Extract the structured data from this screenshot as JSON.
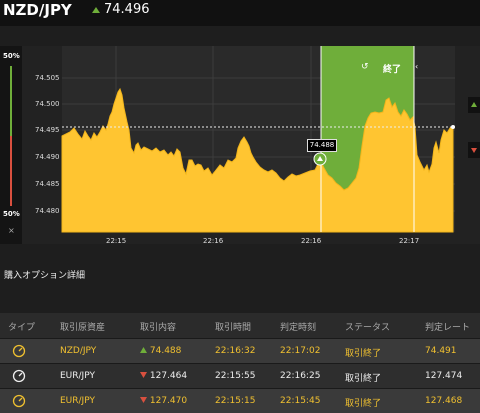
{
  "header": {
    "pair": "NZD/JPY",
    "price": "74.496"
  },
  "left_panel": {
    "top_pct": "50%",
    "bottom_pct": "50%",
    "close": "×"
  },
  "chart": {
    "type": "area",
    "y_ticks": [
      "74.505",
      "74.500",
      "74.495",
      "74.490",
      "74.485",
      "74.480"
    ],
    "x_ticks": [
      "22:15",
      "22:16",
      "22:16",
      "22:17"
    ],
    "callout": "74.488",
    "end_label": "終了",
    "colors": {
      "area": "#ffc531",
      "highlight": "#6fae3a",
      "up": "#6fae3a",
      "down": "#d9503f"
    }
  },
  "section_title": "購入オプション詳細",
  "table": {
    "headers": [
      "タイプ",
      "取引原資産",
      "取引内容",
      "取引時間",
      "判定時刻",
      "ステータス",
      "判定レート"
    ],
    "rows": [
      {
        "asset": "NZD/JPY",
        "direction": "up",
        "content": "74.488",
        "time": "22:16:32",
        "judge": "22:17:02",
        "status": "取引終了",
        "rate": "74.491"
      },
      {
        "asset": "EUR/JPY",
        "direction": "down",
        "content": "127.464",
        "time": "22:15:55",
        "judge": "22:16:25",
        "status": "取引終了",
        "rate": "127.474"
      },
      {
        "asset": "EUR/JPY",
        "direction": "down",
        "content": "127.470",
        "time": "22:15:15",
        "judge": "22:15:45",
        "status": "取引終了",
        "rate": "127.468"
      }
    ]
  }
}
